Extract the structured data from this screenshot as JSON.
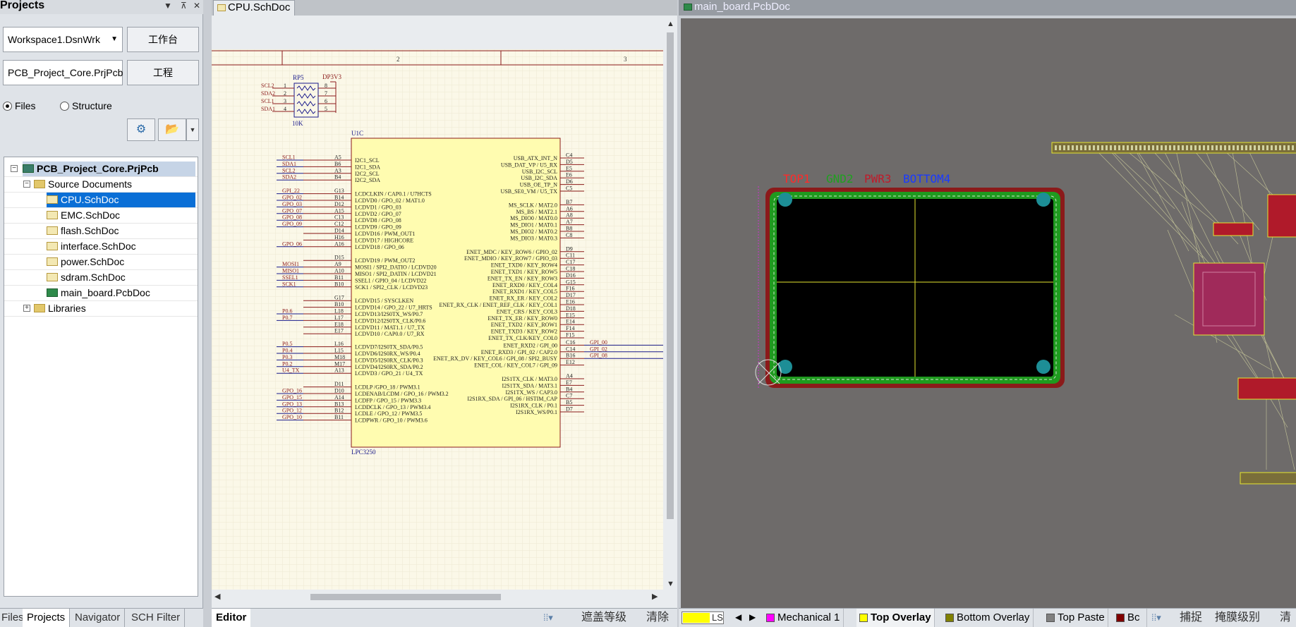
{
  "projects_panel": {
    "title": "Projects",
    "controls": [
      "▼",
      "⊼",
      "✕"
    ],
    "workspace": {
      "value": "Workspace1.DsnWrk",
      "button": "工作台"
    },
    "project": {
      "value": "PCB_Project_Core.PrjPcb",
      "button": "工程"
    },
    "view_mode": {
      "files_label": "Files",
      "structure_label": "Structure",
      "selected": "Files"
    },
    "tree": {
      "root": "PCB_Project_Core.PrjPcb",
      "source_folder": "Source Documents",
      "documents": [
        "CPU.SchDoc",
        "EMC.SchDoc",
        "flash.SchDoc",
        "interface.SchDoc",
        "power.SchDoc",
        "sdram.SchDoc",
        "main_board.PcbDoc"
      ],
      "selected_document": "CPU.SchDoc",
      "libraries": "Libraries"
    },
    "bottom_tabs": [
      "Files",
      "Projects",
      "Navigator",
      "SCH Filter"
    ],
    "active_bottom_tab": "Projects"
  },
  "schematic": {
    "tab": "CPU.SchDoc",
    "border_columns": [
      "2",
      "3"
    ],
    "rp5": {
      "ref": "RP5",
      "value": "10K",
      "net": "DP3V3",
      "nets": [
        "SCL2",
        "SDA2",
        "SCL1",
        "SDA1"
      ],
      "left_pins": [
        "1",
        "2",
        "3",
        "4"
      ],
      "right_pins": [
        "8",
        "7",
        "6",
        "5"
      ]
    },
    "u1c": {
      "ref": "U1C",
      "part": "LPC3250"
    },
    "left_signals": [
      [
        "SCL1",
        "A5",
        "I2C1_SCL"
      ],
      [
        "SDA1",
        "B6",
        "I2C1_SDA"
      ],
      [
        "SCL2",
        "A3",
        "I2C2_SCL"
      ],
      [
        "SDA2",
        "B4",
        "I2C2_SDA"
      ],
      [
        "GPI_22",
        "G13",
        "LCDCLKIN / CAP0.1 / U7HCTS"
      ],
      [
        "GPO_02",
        "B14",
        "LCDVD0 / GPO_02 / MAT1.0"
      ],
      [
        "GPO_03",
        "D12",
        "LCDVD1 / GPO_03"
      ],
      [
        "GPO_07",
        "A15",
        "LCDVD2 / GPO_07"
      ],
      [
        "GPO_08",
        "C13",
        "LCDVD8 / GPO_08"
      ],
      [
        "GPO_09",
        "C12",
        "LCDVD9 / GPO_09"
      ],
      [
        "",
        "D14",
        "LCDVD16 / PWM_OUT1"
      ],
      [
        "",
        "H16",
        "LCDVD17 / HIGHCORE"
      ],
      [
        "GPO_06",
        "A16",
        "LCDVD18 / GPO_06"
      ],
      [
        "",
        "D15",
        "LCDVD19 / PWM_OUT2"
      ],
      [
        "MOSI1",
        "A9",
        "MOSI1 / SPI2_DATIO / LCDVD20"
      ],
      [
        "MISO1",
        "A10",
        "MISO1 / SPI2_DATIN / LCDVD21"
      ],
      [
        "SSEL1",
        "B11",
        "SSEL1 / GPIO_04 / LCDVD22"
      ],
      [
        "SCK1",
        "B10",
        "SCK1 / SPI2_CLK / LCDVD23"
      ],
      [
        "",
        "G17",
        "LCDVD15 / SYSCLKEN"
      ],
      [
        "",
        "B10",
        "LCDVD14 / GPO_22 / U7_HRTS"
      ],
      [
        "P0.6",
        "L18",
        "LCDVD13/I2S0TX_WS/P0.7"
      ],
      [
        "P0.7",
        "L17",
        "LCDVD12/I2S0TX_CLK/P0.6"
      ],
      [
        "",
        "E18",
        "LCDVD11 / MAT1.1 / U7_TX"
      ],
      [
        "",
        "E17",
        "LCDVD10 / CAP0.0 / U7_RX"
      ],
      [
        "P0.5",
        "L16",
        "LCDVD7/I2S0TX_SDA/P0.5"
      ],
      [
        "P0.4",
        "L15",
        "LCDVD6/I2S0RX_WS/P0.4"
      ],
      [
        "P0.3",
        "M18",
        "LCDVD5/I2S0RX_CLK/P0.3"
      ],
      [
        "P0.2",
        "M17",
        "LCDVD4/I2S0RX_SDA/P0.2"
      ],
      [
        "U4_TX",
        "A13",
        "LCDVD3 / GPO_21 / U4_TX"
      ],
      [
        "",
        "D11",
        "LCDLP /GPO_18 / PWM3.1"
      ],
      [
        "GPO_16",
        "D10",
        "LCDENAB/LCDM / GPO_16 / PWM3.2"
      ],
      [
        "GPO_15",
        "A14",
        "LCDFP / GPO_15 / PWM3.3"
      ],
      [
        "GPO_13",
        "B13",
        "LCDDCLK / GPO_13 / PWM3.4"
      ],
      [
        "GPO_12",
        "B12",
        "LCDLE / GPO_12 / PWM3.5"
      ],
      [
        "GPO_10",
        "B11",
        "LCDPWR / GPO_10 / PWM3.6"
      ]
    ],
    "right_signals": [
      [
        "USB_ATX_INT_N",
        "C4",
        ""
      ],
      [
        "USB_DAT_VP / U5_RX",
        "D5",
        ""
      ],
      [
        "USB_I2C_SCL",
        "E5",
        ""
      ],
      [
        "USB_I2C_SDA",
        "E6",
        ""
      ],
      [
        "USB_OE_TP_N",
        "D6",
        ""
      ],
      [
        "USB_SE0_VM / U5_TX",
        "C5",
        ""
      ],
      [
        "MS_SCLK / MAT2.0",
        "B7",
        ""
      ],
      [
        "MS_BS / MAT2.1",
        "A6",
        ""
      ],
      [
        "MS_DIO0 / MAT0.0",
        "A8",
        ""
      ],
      [
        "MS_DIO1 / MAT0.1",
        "A7",
        ""
      ],
      [
        "MS_DIO2 / MAT0.2",
        "B8",
        ""
      ],
      [
        "MS_DIO3 / MAT0.3",
        "C8",
        ""
      ],
      [
        "ENET_MDC / KEY_ROW6 / GPIO_02",
        "D9",
        ""
      ],
      [
        "ENET_MDIO / KEY_ROW7 / GPIO_03",
        "C11",
        ""
      ],
      [
        "ENET_TXD0 / KEY_ROW4",
        "C17",
        ""
      ],
      [
        "ENET_TXD1 / KEY_ROW5",
        "C18",
        ""
      ],
      [
        "ENET_TX_EN / KEY_ROW3",
        "D16",
        ""
      ],
      [
        "ENET_RXD0 / KEY_COL4",
        "G15",
        ""
      ],
      [
        "ENET_RXD1 / KEY_COL5",
        "F16",
        ""
      ],
      [
        "ENET_RX_ER / KEY_COL2",
        "D17",
        ""
      ],
      [
        "ENET_RX_CLK / ENET_REF_CLK / KEY_COL1",
        "E16",
        ""
      ],
      [
        "ENET_CRS / KEY_COL3",
        "D18",
        ""
      ],
      [
        "ENET_TX_ER / KEY_ROW0",
        "E15",
        ""
      ],
      [
        "ENET_TXD2 / KEY_ROW1",
        "E14",
        ""
      ],
      [
        "ENET_TXD3 / KEY_ROW2",
        "F14",
        ""
      ],
      [
        "ENET_TX_CLK/KEY_COL0",
        "F15",
        ""
      ],
      [
        "ENET_RXD2 / GPI_00",
        "C16",
        "GPI_00"
      ],
      [
        "ENET_RXD3 / GPI_02 / CAP2.0",
        "C14",
        "GPI_02"
      ],
      [
        "ENET_RX_DV / KEY_COL6 / GPI_08 / SPI2_BUSY",
        "B16",
        "GPI_08"
      ],
      [
        "ENET_COL / KEY_COL7 / GPI_09",
        "E12",
        ""
      ],
      [
        "I2S1TX_CLK / MAT3.0",
        "A4",
        ""
      ],
      [
        "I2S1TX_SDA / MAT3.1",
        "E7",
        ""
      ],
      [
        "I2S1TX_WS / CAP3.0",
        "B4",
        ""
      ],
      [
        "I2S1RX_SDA / GPI_06 / HSTIM_CAP",
        "C7",
        ""
      ],
      [
        "I2S1RX_CLK / P0.1",
        "B5",
        ""
      ],
      [
        "I2S1RX_WS/P0.1",
        "D7",
        ""
      ]
    ]
  },
  "schematic_bar": {
    "editor_tab": "Editor",
    "mask_level": "遮盖等级",
    "clear": "清除"
  },
  "pcb": {
    "tab": "main_board.PcbDoc",
    "layer_labels": [
      {
        "text": "TOP1",
        "color": "#ff2a2a"
      },
      {
        "text": "GND2",
        "color": "#1fa01f"
      },
      {
        "text": "PWR3",
        "color": "#c01a2a"
      },
      {
        "text": "BOTTOM4",
        "color": "#1a3aff"
      }
    ]
  },
  "layer_bar": {
    "ls_label": "LS",
    "current_color": "#ffff00",
    "layers": [
      {
        "name": "Mechanical 1",
        "color": "#ff00ff"
      },
      {
        "name": "Top Overlay",
        "color": "#ffff00",
        "active": true
      },
      {
        "name": "Bottom Overlay",
        "color": "#808000"
      },
      {
        "name": "Top Paste",
        "color": "#808080"
      },
      {
        "name": "Bc",
        "color": "#800000"
      }
    ],
    "snap": "捕捉",
    "mask_level": "掩膜级别",
    "clear": "清"
  }
}
